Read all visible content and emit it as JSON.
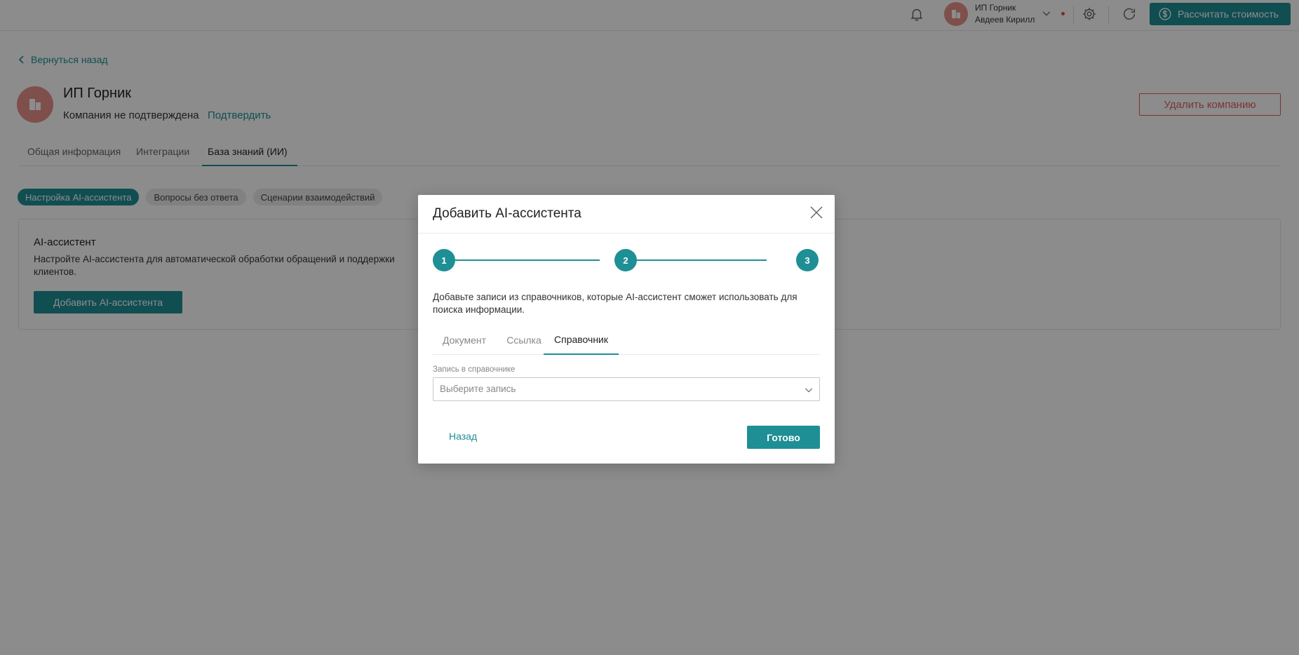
{
  "header": {
    "user_company": "ИП Горник",
    "user_name": "Авдеев Кирилл",
    "calc_button": "Рассчитать стоимость"
  },
  "page": {
    "back_link": "Вернуться назад",
    "company_name": "ИП Горник",
    "company_status": "Компания не подтверждена",
    "confirm_link": "Подтвердить",
    "delete_button": "Удалить компанию",
    "tabs": [
      {
        "label": "Общая информация"
      },
      {
        "label": "Интеграции"
      },
      {
        "label": "База знаний (ИИ)"
      }
    ],
    "chips": [
      {
        "label": "Настройка AI-ассистента"
      },
      {
        "label": "Вопросы без ответа"
      },
      {
        "label": "Сценарии взаимодействий"
      }
    ],
    "card": {
      "title": "AI-ассистент",
      "description": "Настройте AI-ассистента для автоматической обработки обращений и поддержки клиентов.",
      "button": "Добавить AI-ассистента"
    }
  },
  "modal": {
    "title": "Добавить AI-ассистента",
    "steps": [
      "1",
      "2",
      "3"
    ],
    "description": "Добавьте записи из справочников, которые AI-ассистент сможет использовать для поиска информации.",
    "tabs": [
      {
        "label": "Документ"
      },
      {
        "label": "Ссылка"
      },
      {
        "label": "Справочник"
      }
    ],
    "field_label": "Запись в справочнике",
    "select_placeholder": "Выберите запись",
    "back_button": "Назад",
    "done_button": "Готово"
  },
  "colors": {
    "accent": "#1e8f95",
    "danger": "#e06060",
    "avatar": "#e8908a"
  }
}
